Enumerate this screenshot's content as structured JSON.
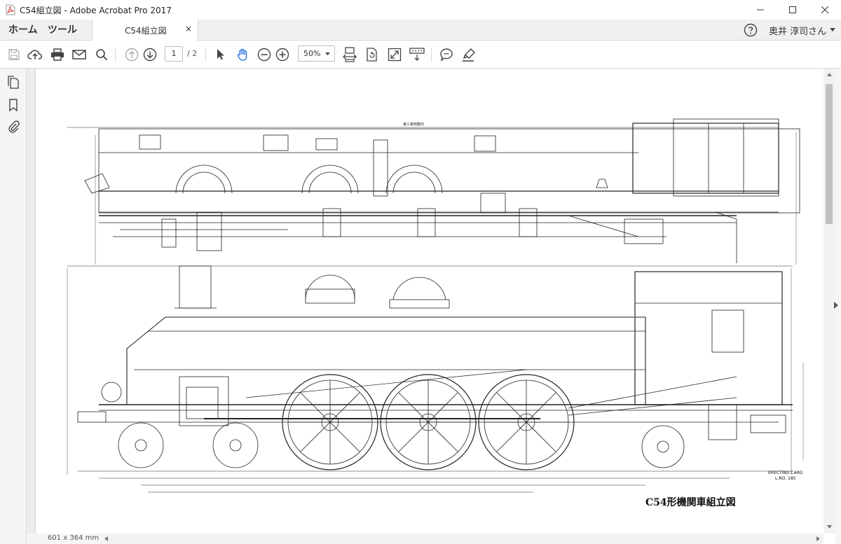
{
  "window": {
    "title": "C54組立図 - Adobe Acrobat Pro 2017"
  },
  "menu": {
    "home": "ホーム",
    "tools": "ツール"
  },
  "tab": {
    "label": "C54組立図",
    "close": "×"
  },
  "user": {
    "name": "奥井 淳司さん"
  },
  "toolbar": {
    "page_current": "1",
    "page_total": "/ 2",
    "zoom": "50%"
  },
  "drawing": {
    "caption": "C54形機関車組立図",
    "plan_title": "第三車両動向",
    "erecting_card": "ERECTING CARD",
    "card_no": "L.NO. 185"
  },
  "status": {
    "page_size": "601 x 364 mm"
  },
  "colors": {
    "accent": "#2d7be0",
    "pdf_red": "#d93025"
  }
}
